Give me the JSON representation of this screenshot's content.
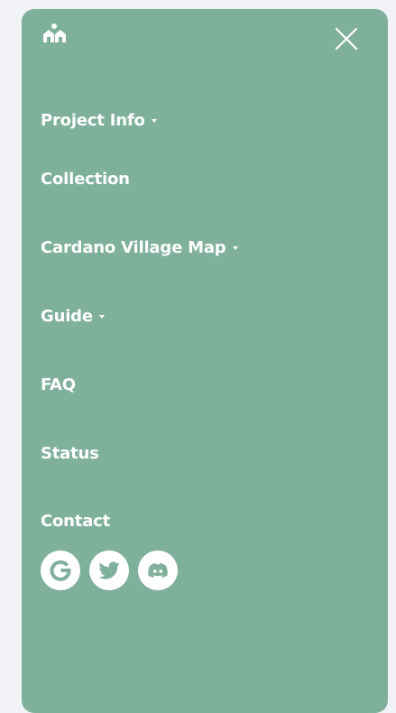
{
  "menu": {
    "items": [
      {
        "label": "Project Info",
        "has_dropdown": true
      },
      {
        "label": "Collection",
        "has_dropdown": false
      },
      {
        "label": "Cardano Village Map",
        "has_dropdown": true
      },
      {
        "label": "Guide",
        "has_dropdown": true
      },
      {
        "label": "FAQ",
        "has_dropdown": false
      },
      {
        "label": "Status",
        "has_dropdown": false
      },
      {
        "label": "Contact",
        "has_dropdown": false
      }
    ]
  },
  "socials": [
    {
      "icon": "google-icon"
    },
    {
      "icon": "twitter-icon"
    },
    {
      "icon": "discord-icon"
    }
  ],
  "colors": {
    "panel": "#7fb09b",
    "page_background": "#f1f3f6",
    "text": "#ffffff"
  }
}
